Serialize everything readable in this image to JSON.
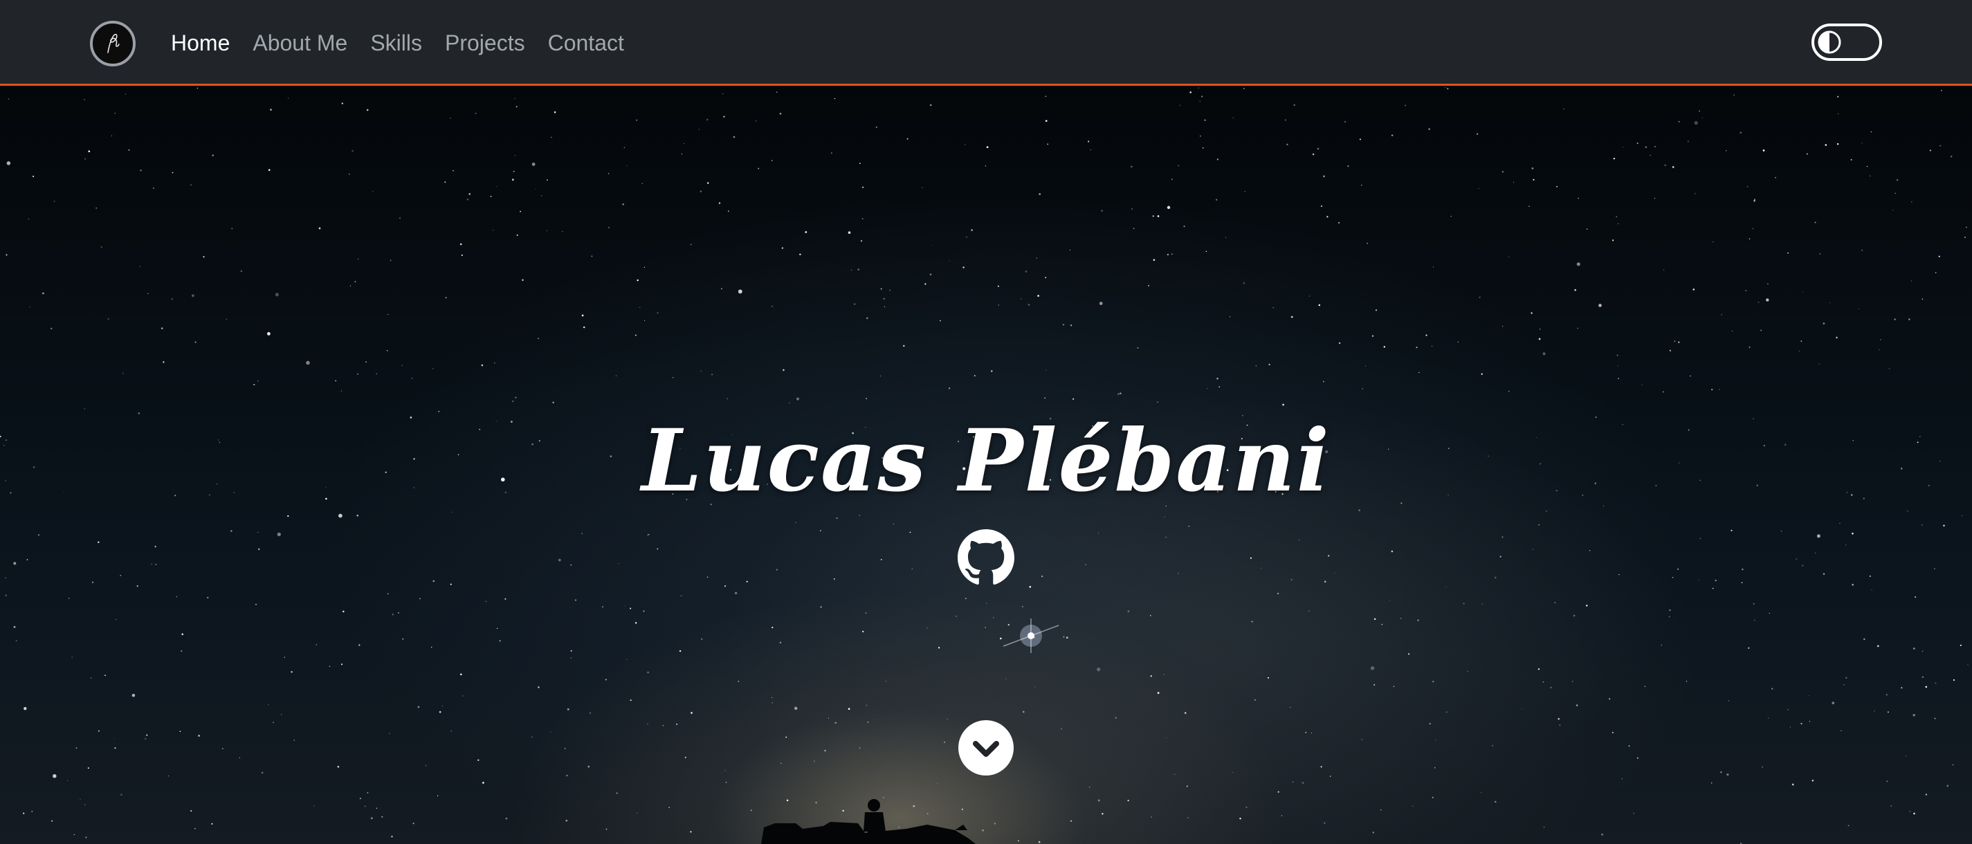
{
  "navbar": {
    "brand_icon": "signature-logo-icon",
    "links": [
      {
        "label": "Home",
        "active": true
      },
      {
        "label": "About Me",
        "active": false
      },
      {
        "label": "Skills",
        "active": false
      },
      {
        "label": "Projects",
        "active": false
      },
      {
        "label": "Contact",
        "active": false
      }
    ],
    "theme_toggle": {
      "icon": "half-moon-contrast-icon",
      "state": "dark"
    },
    "accent_color": "#e0521d",
    "background_color": "#212529"
  },
  "hero": {
    "title": "Lucas Plébani",
    "github_icon": "github-icon",
    "scroll_icon": "chevron-down-icon",
    "background": "starry-night-milky-way-with-person-silhouette"
  }
}
